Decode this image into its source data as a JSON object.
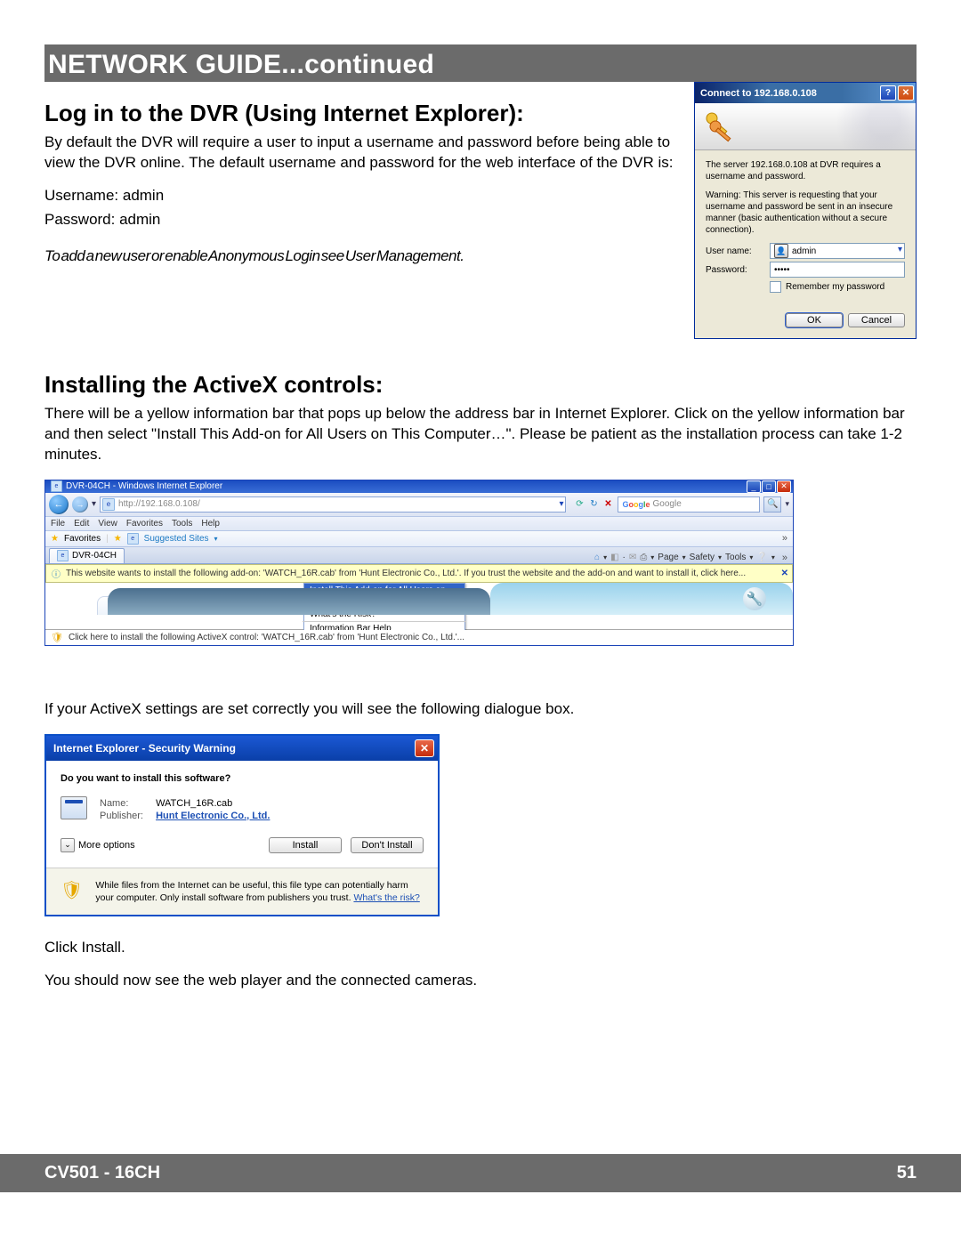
{
  "header": "NETWORK GUIDE...continued",
  "section1": {
    "title": "Log in to the DVR (Using Internet Explorer):",
    "p1": "By default the DVR will require a user to input a username and password before being able to view the DVR online. The default username and password for the web interface of the DVR is:",
    "user_line": "Username: admin",
    "pass_line": "Password: admin",
    "note": "To add a new user or enable Anonymous Login see User Management."
  },
  "login_dialog": {
    "title": "Connect to 192.168.0.108",
    "msg1": "The server 192.168.0.108 at DVR requires a username and password.",
    "msg2": "Warning: This server is requesting that your username and password be sent in an insecure manner (basic authentication without a secure connection).",
    "user_label": "User name:",
    "user_value": "admin",
    "pass_label": "Password:",
    "pass_value": "•••••",
    "remember": "Remember my password",
    "ok": "OK",
    "cancel": "Cancel"
  },
  "section2": {
    "title": "Installing the ActiveX controls:",
    "p1": "There will be a yellow information bar that pops up below the address bar in Internet Explorer. Click on the yellow information bar and then select \"Install This Add-on for All Users on This Computer…\". Please be patient as the installation process can take 1-2 minutes.",
    "p2": "If your ActiveX settings are set correctly you will see the following dialogue box.",
    "p3": "Click Install.",
    "p4": "You should now see the web player and the connected cameras."
  },
  "ie": {
    "title": "DVR-04CH - Windows Internet Explorer",
    "url": "http://192.168.0.108/",
    "search_hint": "Google",
    "menu": [
      "File",
      "Edit",
      "View",
      "Favorites",
      "Tools",
      "Help"
    ],
    "fav_label": "Favorites",
    "suggested": "Suggested Sites",
    "tab": "DVR-04CH",
    "tools": [
      "Page",
      "Safety",
      "Tools"
    ],
    "infobar": "This website wants to install the following add-on: 'WATCH_16R.cab' from 'Hunt Electronic Co., Ltd.'. If you trust the website and the add-on and want to install it, click here...",
    "context": [
      "Install This Add-on for All Users on This Computer...",
      "What's the Risk?",
      "Information Bar Help"
    ],
    "bottom_msg": "Click here to install the following ActiveX control: 'WATCH_16R.cab' from 'Hunt Electronic Co., Ltd.'..."
  },
  "security": {
    "title": "Internet Explorer - Security Warning",
    "q": "Do you want to install this software?",
    "name_k": "Name:",
    "name_v": "WATCH_16R.cab",
    "pub_k": "Publisher:",
    "pub_v": "Hunt Electronic Co., Ltd.",
    "more": "More options",
    "install": "Install",
    "dont": "Don't Install",
    "warn": "While files from the Internet can be useful, this file type can potentially harm your computer. Only install software from publishers you trust.",
    "risk": "What's the risk?"
  },
  "footer": {
    "left": "CV501 - 16CH",
    "right": "51"
  }
}
